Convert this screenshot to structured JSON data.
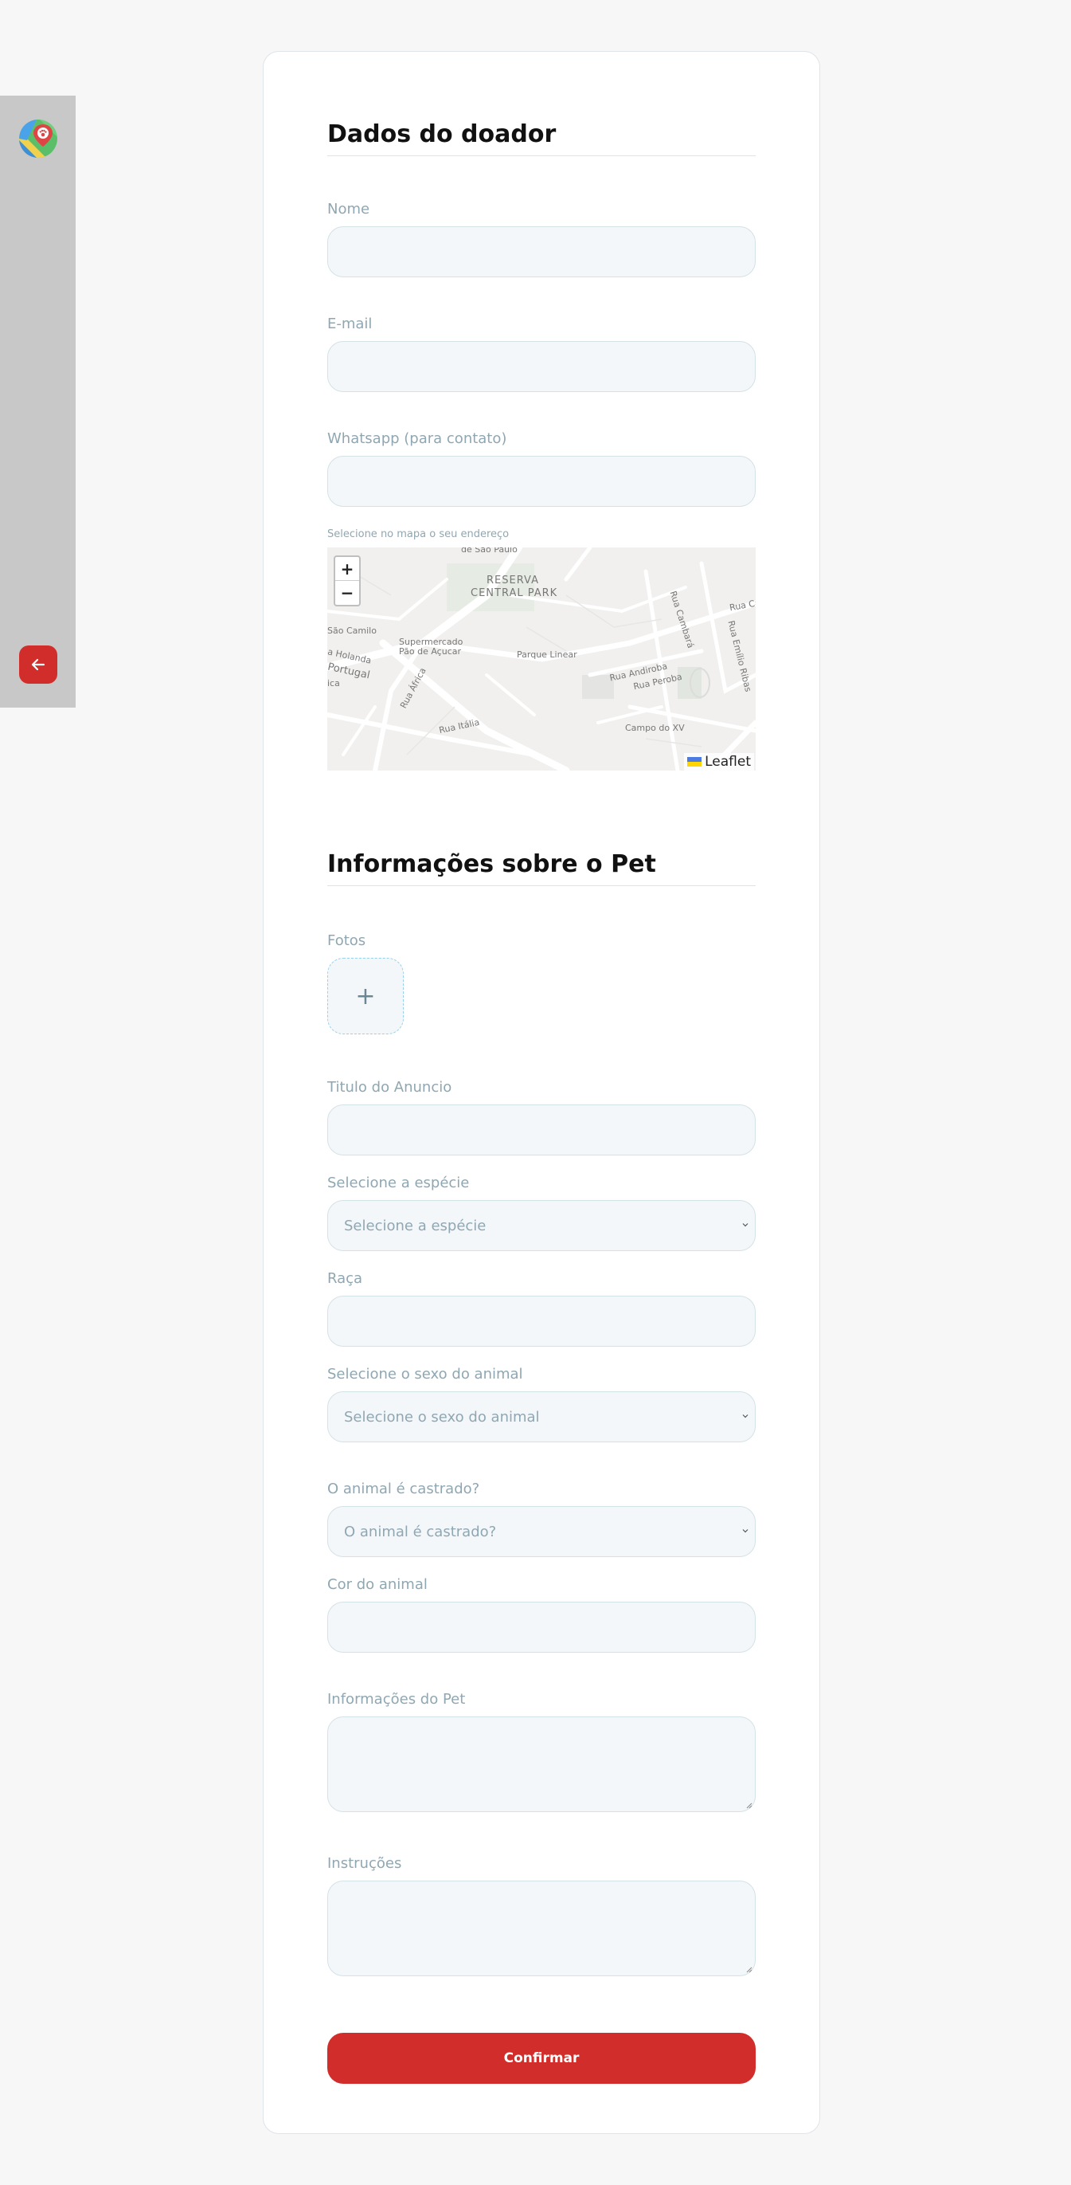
{
  "sidebar": {
    "logo_icon": "map-paw-logo-icon",
    "back_icon": "arrow-left-icon",
    "accent": "#d12e2b"
  },
  "donor": {
    "title": "Dados do doador",
    "name_label": "Nome",
    "email_label": "E-mail",
    "whatsapp_label": "Whatsapp (para contato)",
    "map_hint": "Selecione no mapa o seu endereço"
  },
  "map": {
    "zoom_in": "+",
    "zoom_out": "−",
    "attribution": "Leaflet",
    "labels": {
      "sao_paulo": "de São Paulo",
      "reserva": "RESERVA",
      "central_park": "CENTRAL PARK",
      "sao_camilo": "São Camilo",
      "supermercado": "Supermercado",
      "pao_acucar": "Pão de Açucar",
      "holanda": "a Holanda",
      "portugal": "Portugal",
      "ica": "ica",
      "rua_africa": "Rua África",
      "rua_italia": "Rua Itália",
      "parque_linear": "Parque Linear",
      "rua_cambara": "Rua Cambará",
      "rua_andiroba": "Rua Andiroba",
      "rua_peroba": "Rua Peroba",
      "rua_emilio": "Rua Emílio Ribas",
      "rua_ca": "Rua Ca",
      "campo_xv": "Campo do XV"
    }
  },
  "pet": {
    "title": "Informações sobre o Pet",
    "photos_label": "Fotos",
    "add_photo": "+",
    "ad_title_label": "Titulo do Anuncio",
    "species_label": "Selecione a espécie",
    "species_value": "Selecione a espécie",
    "breed_label": "Raça",
    "sex_label": "Selecione o sexo do animal",
    "sex_value": "Selecione o sexo do animal",
    "castrated_label": "O animal é castrado?",
    "castrated_value": "O animal é castrado?",
    "color_label": "Cor do animal",
    "info_label": "Informações do Pet",
    "instructions_label": "Instruções"
  },
  "actions": {
    "confirm": "Confirmar"
  }
}
